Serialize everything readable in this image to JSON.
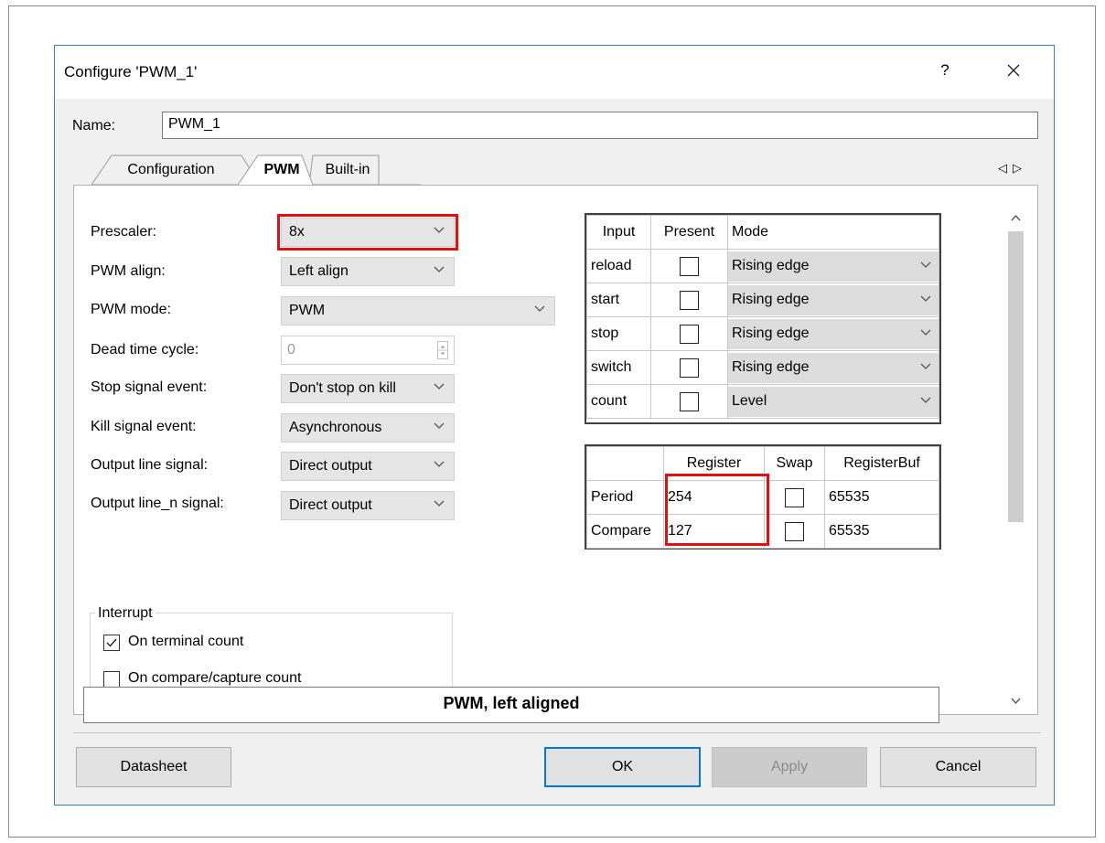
{
  "dialog": {
    "title": "Configure 'PWM_1'",
    "help_label": "?",
    "close_icon": "close-icon"
  },
  "name_field": {
    "label": "Name:",
    "value": "PWM_1"
  },
  "tabs": [
    {
      "label": "Configuration",
      "selected": false
    },
    {
      "label": "PWM",
      "selected": true
    },
    {
      "label": "Built-in",
      "selected": false
    }
  ],
  "tab_scroll": {
    "left": "◁",
    "right": "▷"
  },
  "form": {
    "prescaler": {
      "label": "Prescaler:",
      "value": "8x"
    },
    "pwm_align": {
      "label": "PWM align:",
      "value": "Left align"
    },
    "pwm_mode": {
      "label": "PWM mode:",
      "value": "PWM"
    },
    "dead_time": {
      "label": "Dead time cycle:",
      "value": "0"
    },
    "stop_signal": {
      "label": "Stop signal event:",
      "value": "Don't stop on kill"
    },
    "kill_signal": {
      "label": "Kill signal event:",
      "value": "Asynchronous"
    },
    "output_line": {
      "label": "Output line signal:",
      "value": "Direct output"
    },
    "output_line_n": {
      "label": "Output line_n signal:",
      "value": "Direct output"
    }
  },
  "interrupt": {
    "title": "Interrupt",
    "on_terminal_count": {
      "label": "On terminal count",
      "checked": true
    },
    "on_compare_capture": {
      "label": "On compare/capture count",
      "checked": false
    }
  },
  "inputs_table": {
    "headers": [
      "Input",
      "Present",
      "Mode"
    ],
    "rows": [
      {
        "input": "reload",
        "present": false,
        "mode": "Rising edge"
      },
      {
        "input": "start",
        "present": false,
        "mode": "Rising edge"
      },
      {
        "input": "stop",
        "present": false,
        "mode": "Rising edge"
      },
      {
        "input": "switch",
        "present": false,
        "mode": "Rising edge"
      },
      {
        "input": "count",
        "present": false,
        "mode": "Level"
      }
    ]
  },
  "register_table": {
    "headers": [
      "",
      "Register",
      "Swap",
      "RegisterBuf"
    ],
    "rows": [
      {
        "name": "Period",
        "register": "254",
        "swap": false,
        "buf": "65535"
      },
      {
        "name": "Compare",
        "register": "127",
        "swap": false,
        "buf": "65535"
      }
    ]
  },
  "status_text": "PWM, left aligned",
  "buttons": {
    "datasheet": "Datasheet",
    "ok": "OK",
    "apply": "Apply",
    "cancel": "Cancel"
  },
  "colors": {
    "highlight": "#e01010",
    "dialog_border": "#3c7fb1",
    "ok_border": "#0078d7"
  }
}
